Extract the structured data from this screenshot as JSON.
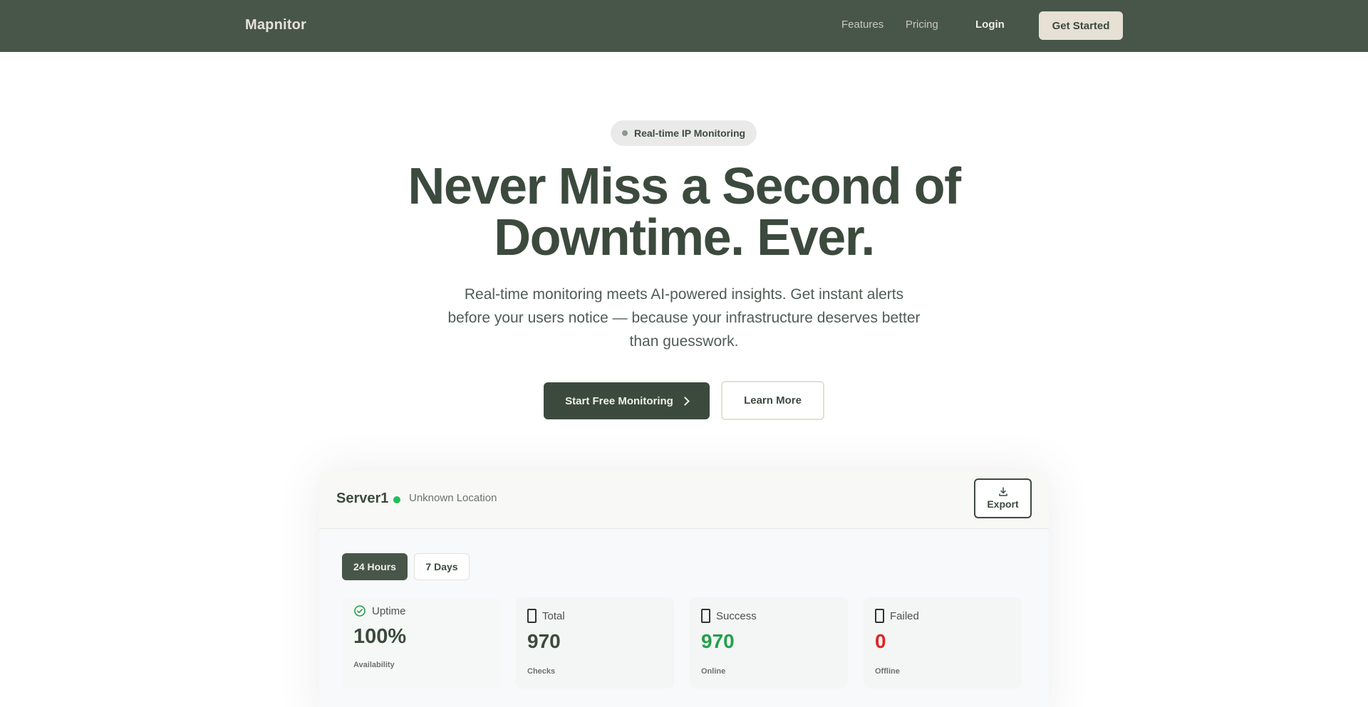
{
  "nav": {
    "brand": "Mapnitor",
    "links": [
      "Features",
      "Pricing"
    ],
    "login": "Login",
    "cta": "Get Started"
  },
  "hero": {
    "badge": "Real-time IP Monitoring",
    "headline_line1": "Never Miss a Second of",
    "headline_line2": "Downtime. Ever.",
    "subtext": "Real-time monitoring meets AI-powered insights. Get instant alerts before your users notice — because your infrastructure deserves better than guesswork.",
    "primary_cta": "Start Free Monitoring",
    "secondary_cta": "Learn More"
  },
  "dashboard": {
    "server_name": "Server1",
    "status": "online",
    "location": "Unknown Location",
    "export_label": "Export",
    "tabs": [
      {
        "label": "24 Hours",
        "active": true
      },
      {
        "label": "7 Days",
        "active": false
      }
    ],
    "stats": [
      {
        "label": "Uptime",
        "value": "100%",
        "sub": "Availability",
        "icon": "check-circle-icon"
      },
      {
        "label": "Total",
        "value": "970",
        "sub": "Checks",
        "icon": "box-icon"
      },
      {
        "label": "Success",
        "value": "970",
        "sub": "Online",
        "icon": "box-icon"
      },
      {
        "label": "Failed",
        "value": "0",
        "sub": "Offline",
        "icon": "box-icon"
      }
    ]
  },
  "colors": {
    "nav_bg": "#48564a",
    "primary": "#3c4a3e",
    "accent_cream": "#e6e0d5",
    "success": "#23a04b",
    "danger": "#dc2626",
    "status_online": "#1fbf55"
  }
}
